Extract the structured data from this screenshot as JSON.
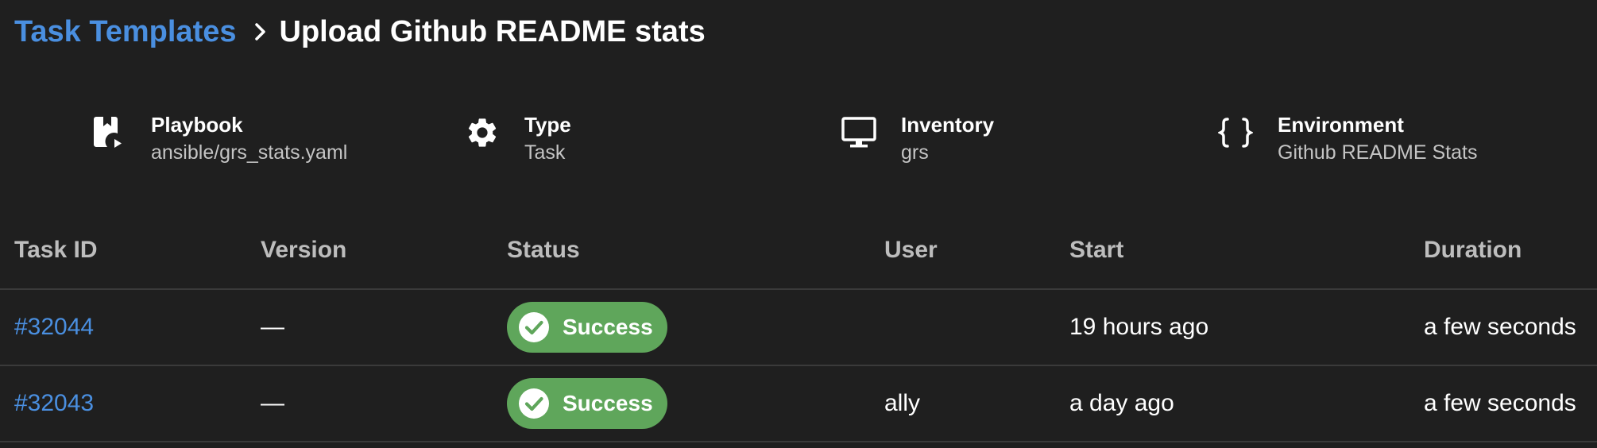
{
  "breadcrumb": {
    "parent": "Task Templates",
    "current": "Upload Github README stats"
  },
  "info": {
    "playbook": {
      "label": "Playbook",
      "value": "ansible/grs_stats.yaml",
      "icon": "playbook-icon"
    },
    "type": {
      "label": "Type",
      "value": "Task",
      "icon": "gear-icon"
    },
    "inventory": {
      "label": "Inventory",
      "value": "grs",
      "icon": "monitor-icon"
    },
    "environment": {
      "label": "Environment",
      "value": "Github README Stats",
      "icon": "braces-icon"
    }
  },
  "table": {
    "headers": {
      "task_id": "Task ID",
      "version": "Version",
      "status": "Status",
      "user": "User",
      "start": "Start",
      "duration": "Duration"
    },
    "rows": [
      {
        "task_id": "#32044",
        "version": "—",
        "status": "Success",
        "user": "",
        "start": "19 hours ago",
        "duration": "a few seconds"
      },
      {
        "task_id": "#32043",
        "version": "—",
        "status": "Success",
        "user": "ally",
        "start": "a day ago",
        "duration": "a few seconds"
      }
    ]
  },
  "colors": {
    "background": "#1f1f1f",
    "link": "#4a8fe0",
    "success": "#5fa65b"
  }
}
